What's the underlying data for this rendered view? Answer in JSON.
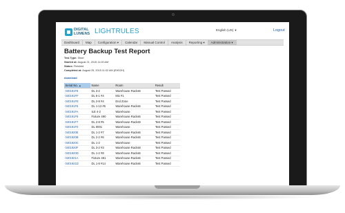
{
  "app": {
    "logo_line1": "DIGITAL",
    "logo_line2": "LUMENS",
    "brand": "LIGHTRULES",
    "language": "English (US)",
    "logout": "Logout"
  },
  "nav": [
    "Dashboard",
    "Map",
    "Configuration ▾",
    "Calendar",
    "Manual Control",
    "Analysis",
    "Reporting ▾",
    "Administration ▾"
  ],
  "report": {
    "title": "Battery Backup Test Report",
    "test_type_label": "Test Type:",
    "test_type": "Short",
    "started_label": "Started at:",
    "started": "August 21, 2015 11:00 AM",
    "status_label": "Status:",
    "status": "Finished",
    "completed_label": "Completed at:",
    "completed": "August 25, 2015 11:02 AM (EHD2H)",
    "download": "download"
  },
  "table": {
    "headers": [
      "Serial No.",
      "Name",
      "Room",
      "Result"
    ],
    "rows": [
      [
        "040191F8",
        "DL 3-2",
        "Warehouse Racks6",
        "Test Passed"
      ],
      [
        "040191FF",
        "DL 5-1 #4",
        "Mix #1",
        "Test Passed"
      ],
      [
        "040191FE",
        "DL 2-8 #4",
        "End Zone",
        "Test Passed"
      ],
      [
        "040191F6",
        "DL 1-13 #6",
        "Warehouse Racks6",
        "Test Passed"
      ],
      [
        "040191FA",
        "ILE 4-2",
        "Warehouse",
        "Test Passed"
      ],
      [
        "040191F9",
        "Fixture 490",
        "Warehouse Racks6",
        "Test Passed"
      ],
      [
        "040191F7",
        "DL 2-8 #5",
        "Warehouse Racks9",
        "Test Passed"
      ],
      [
        "040191F0",
        "DL 0001",
        "Warehouse",
        "Test Passed"
      ],
      [
        "0401920E",
        "DL 1-2 #7",
        "Warehouse Racks6",
        "Test Passed"
      ],
      [
        "0401920B",
        "DL 2-2 #6",
        "Warehouse Racks6",
        "Test Passed"
      ],
      [
        "0401920C",
        "DL 1-2",
        "Warehouse",
        "Test Passed"
      ],
      [
        "0401920F",
        "DL 3-2 #3",
        "Warehouse Racks8",
        "Test Passed"
      ],
      [
        "0401920D",
        "DL 1-2 #8",
        "Warehouse Racks6",
        "Test Passed"
      ],
      [
        "0401921A",
        "Fixture 491",
        "Warehouse Racks6",
        "Test Passed"
      ],
      [
        "0401921D",
        "DL 1-8 #14",
        "Warehouse Racks6",
        "Test Passed"
      ]
    ]
  }
}
